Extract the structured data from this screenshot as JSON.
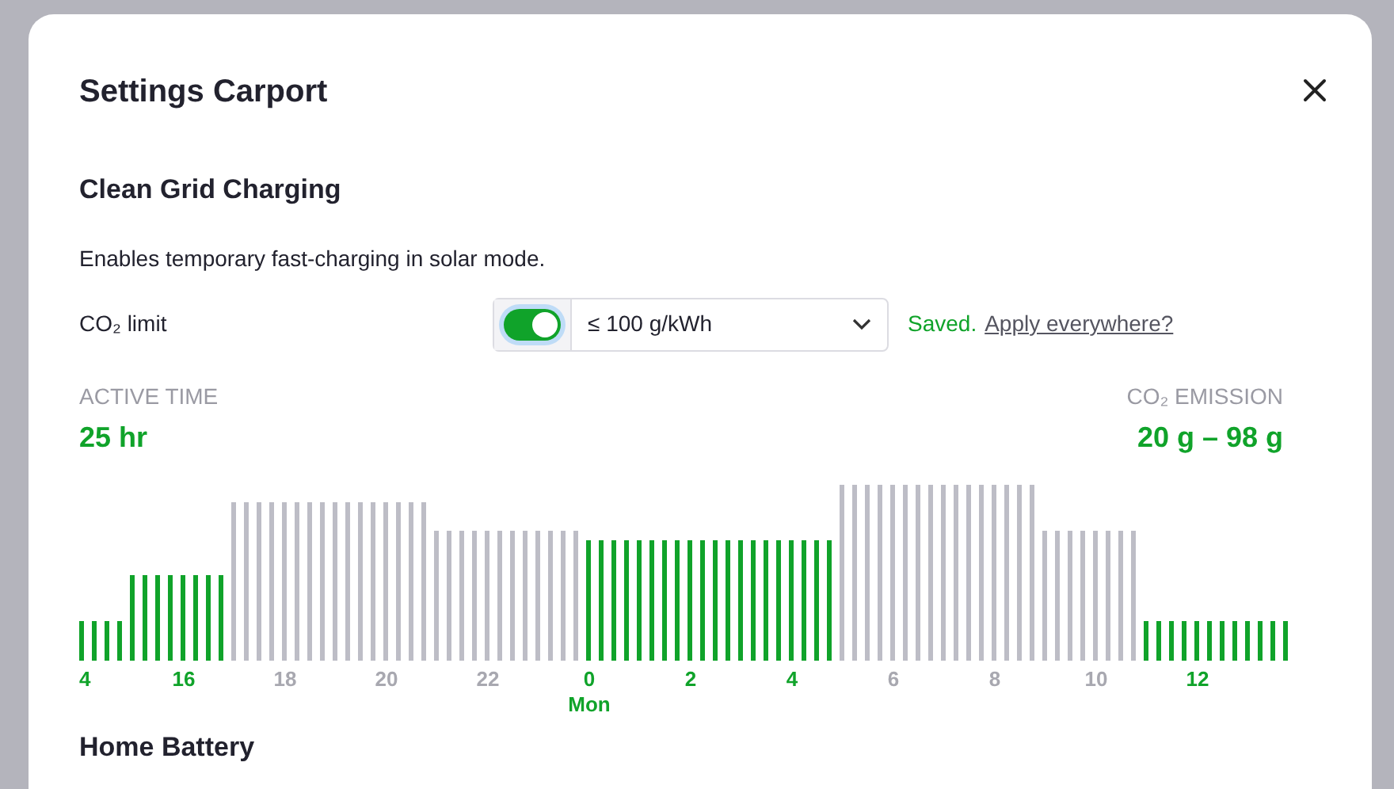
{
  "dialog": {
    "title": "Settings Carport"
  },
  "clean_grid": {
    "heading": "Clean Grid Charging",
    "description": "Enables temporary fast-charging in solar mode.",
    "limit_label": "CO₂ limit",
    "toggle": {
      "on": true
    },
    "select": {
      "value": "≤ 100 g/kWh"
    },
    "status": "Saved.",
    "link": "Apply everywhere?",
    "active_time": {
      "label": "ACTIVE TIME",
      "value": "25 hr"
    },
    "emission": {
      "label": "CO₂ EMISSION",
      "value": "20 g – 98 g"
    },
    "hours": [
      {
        "level": 0.22,
        "active": true
      },
      {
        "level": 0.48,
        "active": true
      },
      {
        "level": 0.48,
        "active": true
      },
      {
        "level": 0.9,
        "active": false
      },
      {
        "level": 0.9,
        "active": false
      },
      {
        "level": 0.9,
        "active": false
      },
      {
        "level": 0.9,
        "active": false
      },
      {
        "level": 0.73,
        "active": false
      },
      {
        "level": 0.73,
        "active": false
      },
      {
        "level": 0.73,
        "active": false
      },
      {
        "level": 0.68,
        "active": true
      },
      {
        "level": 0.68,
        "active": true
      },
      {
        "level": 0.68,
        "active": true
      },
      {
        "level": 0.68,
        "active": true
      },
      {
        "level": 0.68,
        "active": true
      },
      {
        "level": 1,
        "active": false
      },
      {
        "level": 1,
        "active": false
      },
      {
        "level": 1,
        "active": false
      },
      {
        "level": 1,
        "active": false
      },
      {
        "level": 0.73,
        "active": false
      },
      {
        "level": 0.73,
        "active": false
      },
      {
        "level": 0.22,
        "active": true
      },
      {
        "level": 0.22,
        "active": true
      },
      {
        "level": 0.22,
        "active": true
      }
    ],
    "ticks": [
      "4",
      "16",
      "18",
      "20",
      "22",
      "0",
      "2",
      "4",
      "6",
      "8",
      "10",
      "12"
    ],
    "day_label": "Mon"
  },
  "home_battery": {
    "heading": "Home Battery"
  }
}
